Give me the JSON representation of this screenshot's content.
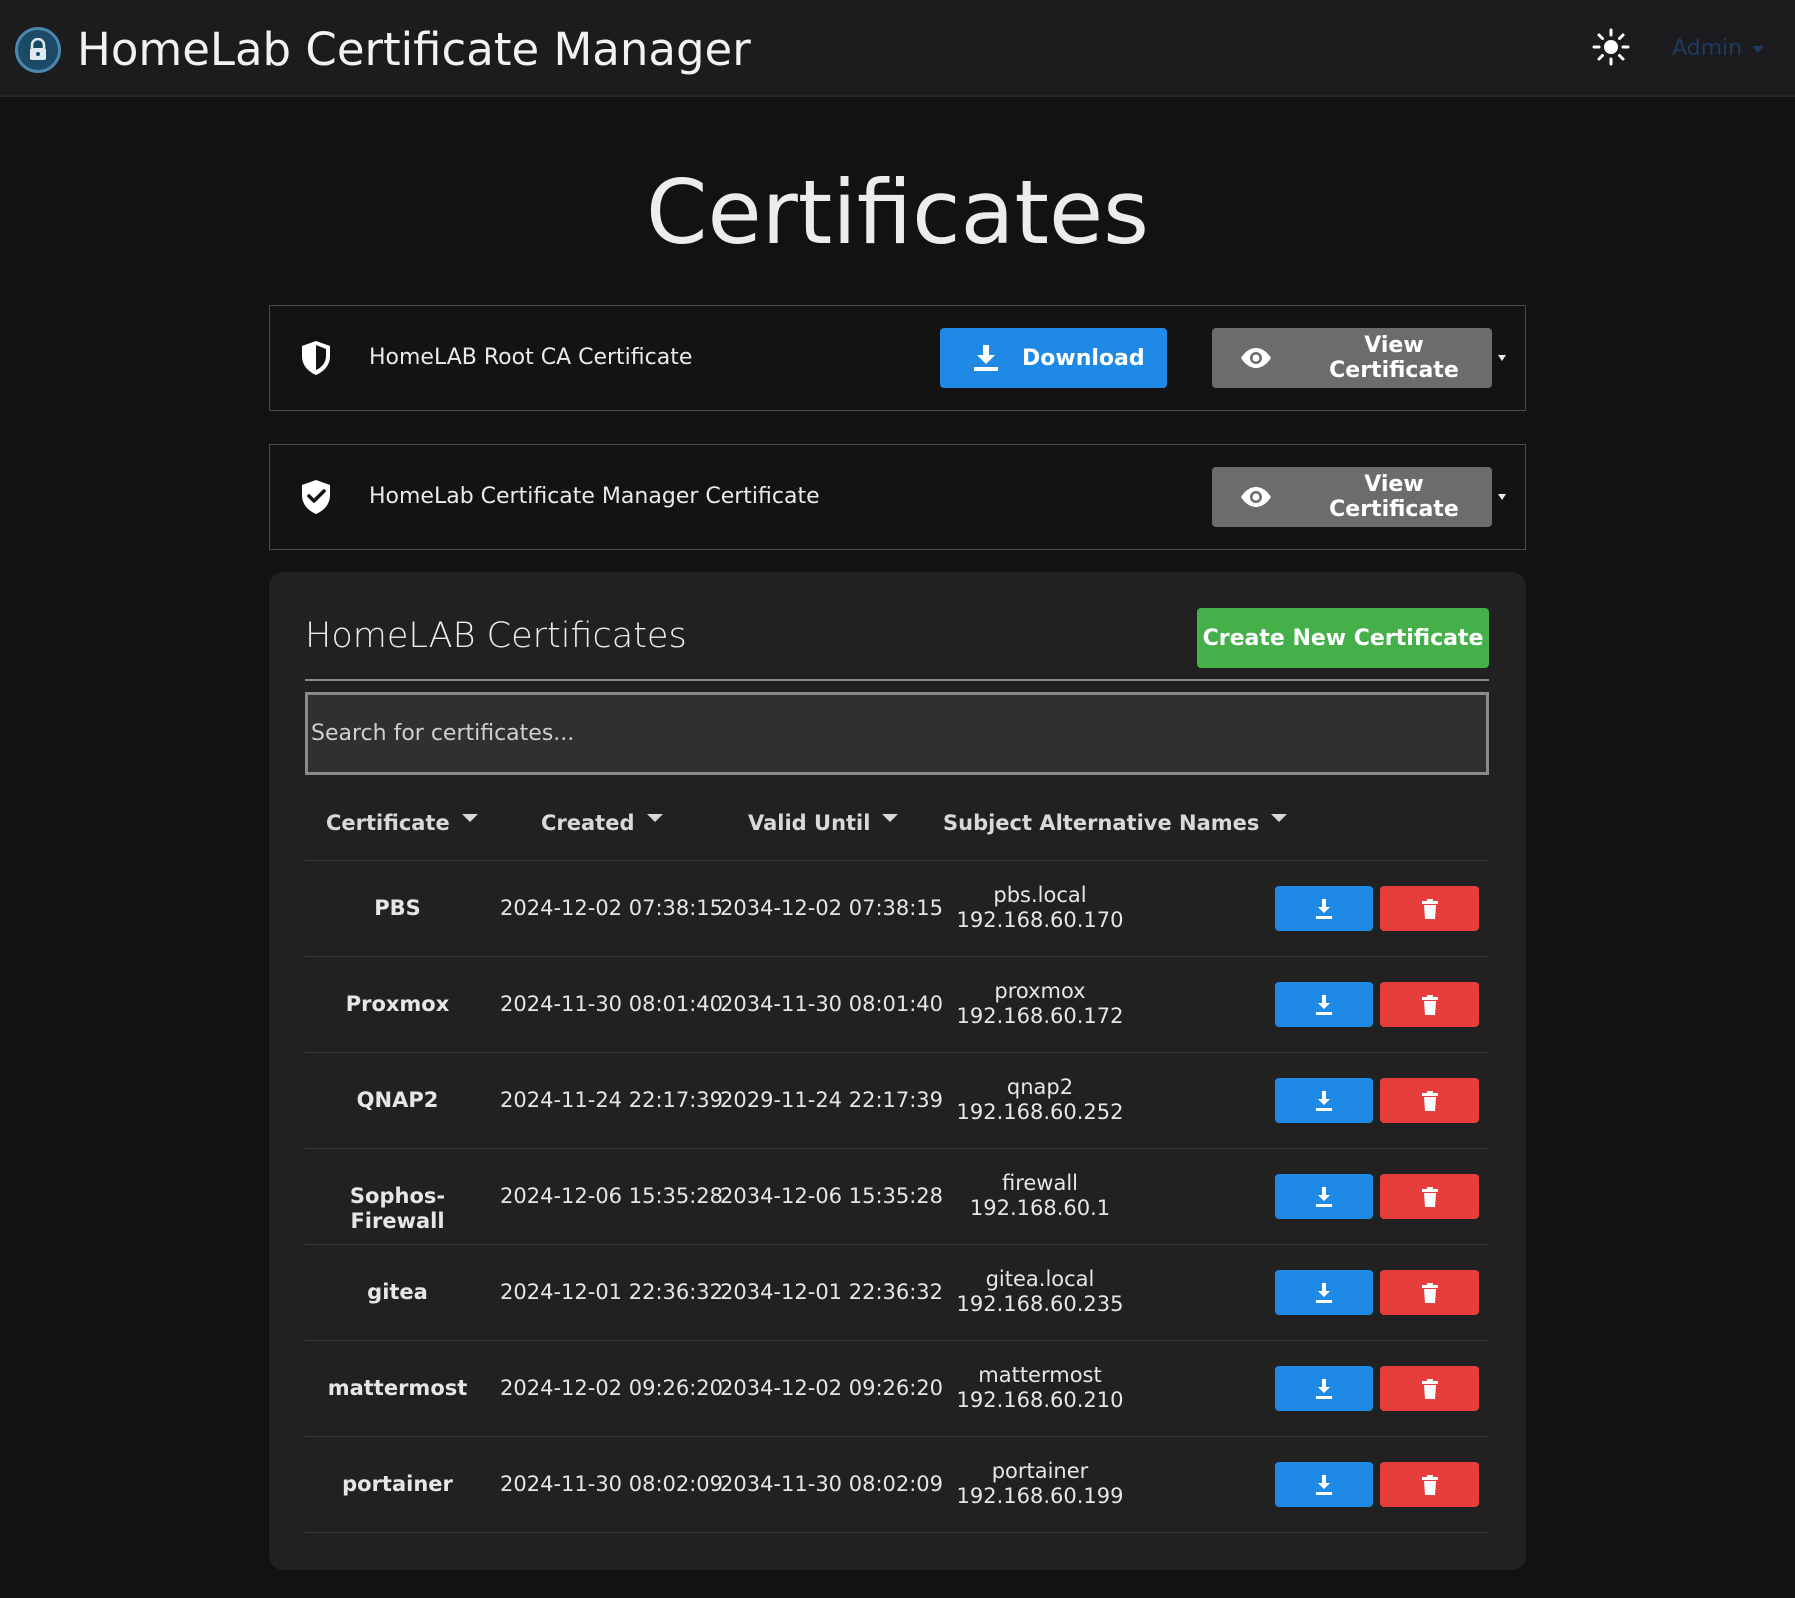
{
  "navbar": {
    "brand_title": "HomeLab Certificate Manager",
    "theme_icon": "sun-icon",
    "admin_label": "Admin"
  },
  "page_title": "Certificates",
  "root_ca": {
    "label": "HomeLAB Root CA Certificate",
    "download_label": "Download",
    "view_label": "View Certificate"
  },
  "manager_cert": {
    "label": "HomeLab Certificate Manager Certificate",
    "view_label": "View Certificate"
  },
  "certs_panel": {
    "title": "HomeLAB Certificates",
    "create_label": "Create New Certificate",
    "search_placeholder": "Search for certificates...",
    "columns": [
      "Certificate",
      "Created",
      "Valid Until",
      "Subject Alternative Names"
    ],
    "rows": [
      {
        "name": "PBS",
        "created": "2024-12-02 07:38:15",
        "valid_until": "2034-12-02 07:38:15",
        "san": [
          "pbs.local",
          "192.168.60.170"
        ]
      },
      {
        "name": "Proxmox",
        "created": "2024-11-30 08:01:40",
        "valid_until": "2034-11-30 08:01:40",
        "san": [
          "proxmox",
          "192.168.60.172"
        ]
      },
      {
        "name": "QNAP2",
        "created": "2024-11-24 22:17:39",
        "valid_until": "2029-11-24 22:17:39",
        "san": [
          "qnap2",
          "192.168.60.252"
        ]
      },
      {
        "name": "Sophos-Firewall",
        "created": "2024-12-06 15:35:28",
        "valid_until": "2034-12-06 15:35:28",
        "san": [
          "firewall",
          "192.168.60.1"
        ]
      },
      {
        "name": "gitea",
        "created": "2024-12-01 22:36:32",
        "valid_until": "2034-12-01 22:36:32",
        "san": [
          "gitea.local",
          "192.168.60.235"
        ]
      },
      {
        "name": "mattermost",
        "created": "2024-12-02 09:26:20",
        "valid_until": "2034-12-02 09:26:20",
        "san": [
          "mattermost",
          "192.168.60.210"
        ]
      },
      {
        "name": "portainer",
        "created": "2024-11-30 08:02:09",
        "valid_until": "2034-11-30 08:02:09",
        "san": [
          "portainer",
          "192.168.60.199"
        ]
      }
    ]
  },
  "colors": {
    "primary": "#1f8ae5",
    "danger": "#e83d3d",
    "success": "#45b04a",
    "secondary": "#6c6c6c"
  }
}
